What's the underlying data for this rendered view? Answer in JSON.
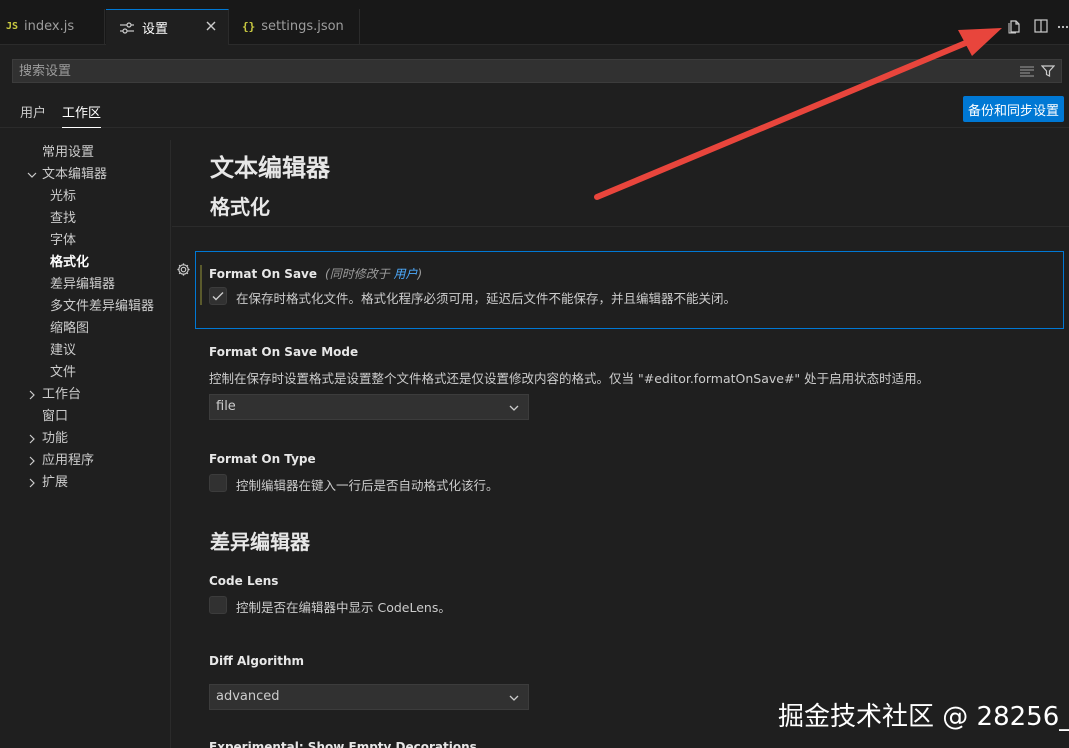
{
  "tabs": [
    {
      "icon": "JS",
      "label": "index.js"
    },
    {
      "label": "设置"
    },
    {
      "icon": "{}",
      "label": "settings.json"
    }
  ],
  "search": {
    "placeholder": "搜索设置"
  },
  "scope_tabs": {
    "user": "用户",
    "workspace": "工作区"
  },
  "sync_button": "备份和同步设置",
  "toc": [
    {
      "label": "常用设置"
    },
    {
      "label": "文本编辑器",
      "expanded": true
    },
    {
      "label": "光标"
    },
    {
      "label": "查找"
    },
    {
      "label": "字体"
    },
    {
      "label": "格式化",
      "active": true
    },
    {
      "label": "差异编辑器"
    },
    {
      "label": "多文件差异编辑器"
    },
    {
      "label": "缩略图"
    },
    {
      "label": "建议"
    },
    {
      "label": "文件"
    },
    {
      "label": "工作台",
      "expanded": false
    },
    {
      "label": "窗口"
    },
    {
      "label": "功能",
      "expanded": false
    },
    {
      "label": "应用程序",
      "expanded": false
    },
    {
      "label": "扩展",
      "expanded": false
    }
  ],
  "content": {
    "section_title": "文本编辑器",
    "subsection_title": "格式化",
    "format_on_save": {
      "title": "Format On Save",
      "modified_prefix": "(同时修改于 ",
      "modified_link": "用户",
      "modified_suffix": ")",
      "checked": true,
      "description": "在保存时格式化文件。格式化程序必须可用，延迟后文件不能保存，并且编辑器不能关闭。"
    },
    "format_on_save_mode": {
      "title": "Format On Save Mode",
      "description": "控制在保存时设置格式是设置整个文件格式还是仅设置修改内容的格式。仅当 \"#editor.formatOnSave#\" 处于启用状态时适用。",
      "value": "file"
    },
    "format_on_type": {
      "title": "Format On Type",
      "checked": false,
      "description": "控制编辑器在键入一行后是否自动格式化该行。"
    },
    "diff_section_title": "差异编辑器",
    "code_lens": {
      "title": "Code Lens",
      "checked": false,
      "description": "控制是否在编辑器中显示 CodeLens。"
    },
    "diff_algorithm": {
      "title": "Diff Algorithm",
      "value": "advanced"
    },
    "next_setting_title": "Experimental: Show Empty Decorations"
  },
  "watermark": "掘金技术社区 @ 28256_",
  "colors": {
    "accent": "#0078d4",
    "arrow": "#e8453c"
  }
}
